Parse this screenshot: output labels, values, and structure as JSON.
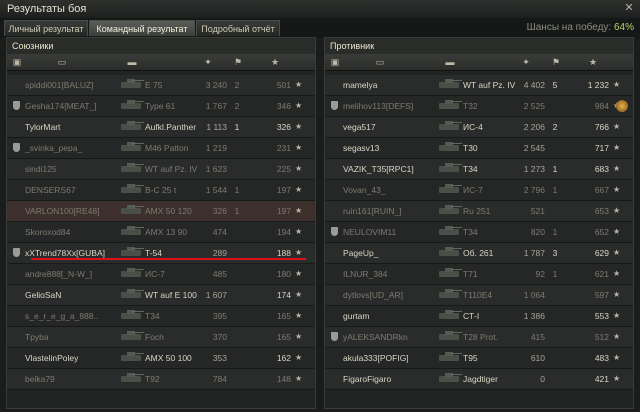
{
  "window": {
    "title": "Результаты боя",
    "close_icon": "close-icon"
  },
  "tabs": [
    {
      "label": "Личный результат",
      "active": false
    },
    {
      "label": "Командный результат",
      "active": true
    },
    {
      "label": "Подробный отчёт",
      "active": false
    }
  ],
  "win_chance": {
    "label": "Шансы на победу:",
    "value": "64%"
  },
  "allies": {
    "title": "Союзники",
    "rows": [
      {
        "player": "spiddi001[BALUZ]",
        "tank": "E 75",
        "damage": "3 240",
        "kills": "2",
        "xp": "501",
        "dead": true,
        "platoon": false
      },
      {
        "player": "Gesha174[MEAT_]",
        "tank": "Type 61",
        "damage": "1 767",
        "kills": "2",
        "xp": "346",
        "dead": true,
        "platoon": true
      },
      {
        "player": "TylorMart",
        "tank": "Aufkl.Panther",
        "damage": "1 113",
        "kills": "1",
        "xp": "326",
        "dead": false,
        "platoon": false
      },
      {
        "player": "_svinka_pepa_",
        "tank": "M46 Patton",
        "damage": "1 219",
        "kills": "",
        "xp": "231",
        "dead": true,
        "platoon": true
      },
      {
        "player": "sindi125",
        "tank": "WT auf Pz. IV",
        "damage": "1 623",
        "kills": "",
        "xp": "225",
        "dead": true,
        "platoon": false
      },
      {
        "player": "DENSERS67",
        "tank": "B-C 25 t",
        "damage": "1 544",
        "kills": "1",
        "xp": "197",
        "dead": true,
        "platoon": false
      },
      {
        "player": "VARLON100[RE48]",
        "tank": "AMX 50 120",
        "damage": "326",
        "kills": "1",
        "xp": "197",
        "dead": true,
        "platoon": false,
        "self": true
      },
      {
        "player": "Skoroxod84",
        "tank": "AMX 13 90",
        "damage": "474",
        "kills": "",
        "xp": "194",
        "dead": true,
        "platoon": false
      },
      {
        "player": "xXTrend78Xx[GUBA]",
        "tank": "T-54",
        "damage": "289",
        "kills": "",
        "xp": "188",
        "dead": false,
        "platoon": true
      },
      {
        "player": "andre888[_N-W_]",
        "tank": "ИС-7",
        "damage": "485",
        "kills": "",
        "xp": "180",
        "dead": true,
        "platoon": false
      },
      {
        "player": "GelioSaN",
        "tank": "WT auf E 100",
        "damage": "1 607",
        "kills": "",
        "xp": "174",
        "dead": false,
        "platoon": false
      },
      {
        "player": "s_e_r_e_g_a_888..",
        "tank": "T34",
        "damage": "395",
        "kills": "",
        "xp": "165",
        "dead": true,
        "platoon": false
      },
      {
        "player": "Tpyba",
        "tank": "Foch",
        "damage": "370",
        "kills": "",
        "xp": "165",
        "dead": true,
        "platoon": false
      },
      {
        "player": "VlastelinPoley",
        "tank": "AMX 50 100",
        "damage": "353",
        "kills": "",
        "xp": "162",
        "dead": false,
        "platoon": false
      },
      {
        "player": "belka79",
        "tank": "T92",
        "damage": "784",
        "kills": "",
        "xp": "148",
        "dead": true,
        "platoon": false
      }
    ]
  },
  "enemies": {
    "title": "Противник",
    "rows": [
      {
        "player": "mamelya",
        "tank": "WT auf Pz. IV",
        "damage": "4 402",
        "kills": "5",
        "xp": "1 232",
        "dead": false,
        "platoon": false
      },
      {
        "player": "melihov113[DEFS]",
        "tank": "T32",
        "damage": "2 525",
        "kills": "",
        "xp": "984",
        "dead": true,
        "platoon": true,
        "medal": true
      },
      {
        "player": "vega517",
        "tank": "ИС-4",
        "damage": "2 206",
        "kills": "2",
        "xp": "766",
        "dead": false,
        "platoon": false
      },
      {
        "player": "segasv13",
        "tank": "T30",
        "damage": "2 545",
        "kills": "",
        "xp": "717",
        "dead": false,
        "platoon": false
      },
      {
        "player": "VAZIK_T35[RPC1]",
        "tank": "T34",
        "damage": "1 273",
        "kills": "1",
        "xp": "683",
        "dead": false,
        "platoon": false
      },
      {
        "player": "Vovan_43_",
        "tank": "ИС-7",
        "damage": "2 796",
        "kills": "1",
        "xp": "667",
        "dead": true,
        "platoon": false
      },
      {
        "player": "ruin161[RUIN_]",
        "tank": "Ru 251",
        "damage": "521",
        "kills": "",
        "xp": "653",
        "dead": true,
        "platoon": false
      },
      {
        "player": "NEULOVIM11",
        "tank": "T34",
        "damage": "820",
        "kills": "1",
        "xp": "652",
        "dead": true,
        "platoon": true
      },
      {
        "player": "PageUp_",
        "tank": "Об. 261",
        "damage": "1 787",
        "kills": "3",
        "xp": "629",
        "dead": false,
        "platoon": false
      },
      {
        "player": "ILNUR_384",
        "tank": "T71",
        "damage": "92",
        "kills": "1",
        "xp": "621",
        "dead": true,
        "platoon": false
      },
      {
        "player": "dytlovs[UD_AR]",
        "tank": "T110E4",
        "damage": "1 064",
        "kills": "",
        "xp": "597",
        "dead": true,
        "platoon": false
      },
      {
        "player": "gurtam",
        "tank": "СТ-I",
        "damage": "1 386",
        "kills": "",
        "xp": "553",
        "dead": false,
        "platoon": false
      },
      {
        "player": "yALEKSANDRkn",
        "tank": "T28 Prot.",
        "damage": "415",
        "kills": "",
        "xp": "512",
        "dead": true,
        "platoon": true
      },
      {
        "player": "akula333[POFIG]",
        "tank": "T95",
        "damage": "610",
        "kills": "",
        "xp": "483",
        "dead": false,
        "platoon": false
      },
      {
        "player": "FigaroFigaro",
        "tank": "Jagdtiger",
        "damage": "0",
        "kills": "",
        "xp": "421",
        "dead": false,
        "platoon": false
      }
    ]
  }
}
